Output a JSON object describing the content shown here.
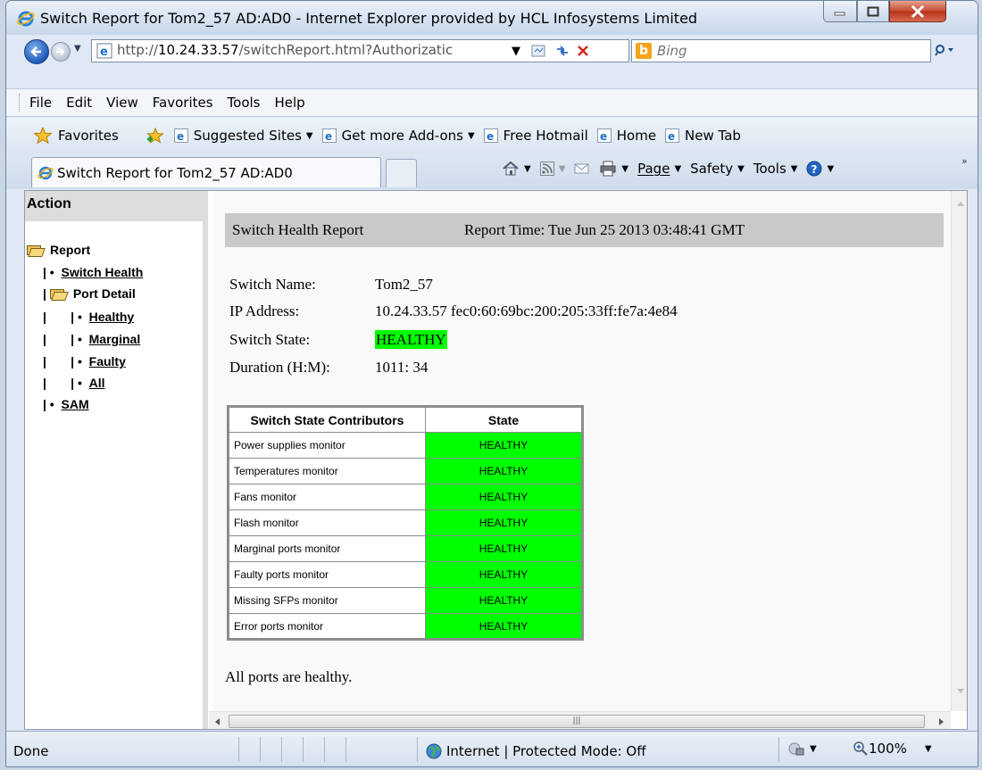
{
  "window": {
    "title": "Switch Report for Tom2_57 AD:AD0 - Internet Explorer provided by HCL Infosystems Limited"
  },
  "address": {
    "url_prefix": "http://",
    "url_host": "10.24.33.57",
    "url_path": "/switchReport.html?Authorizatic",
    "search_placeholder": "Bing"
  },
  "menu": [
    "File",
    "Edit",
    "View",
    "Favorites",
    "Tools",
    "Help"
  ],
  "favorites": {
    "label": "Favorites",
    "links": [
      "Suggested Sites",
      "Get more Add-ons",
      "Free Hotmail",
      "Home",
      "New Tab"
    ]
  },
  "tab": {
    "title": "Switch Report for Tom2_57 AD:AD0"
  },
  "commands": {
    "page": "Page",
    "safety": "Safety",
    "tools": "Tools"
  },
  "left_frame": {
    "header": "Action",
    "tree": {
      "report": "Report",
      "switch_health": "Switch Health",
      "port_detail": "Port Detail",
      "healthy": "Healthy",
      "marginal": "Marginal",
      "faulty": "Faulty",
      "all": "All",
      "sam": "SAM"
    }
  },
  "report": {
    "title": "Switch Health Report",
    "time": "Report Time: Tue Jun 25 2013 03:48:41 GMT",
    "switch_name_label": "Switch Name:",
    "switch_name": "Tom2_57",
    "ip_label": "IP Address:",
    "ip": "10.24.33.57 fec0:60:69bc:200:205:33ff:fe7a:4e84",
    "state_label": "Switch State:",
    "state": "HEALTHY",
    "duration_label": "Duration (H:M):",
    "duration": "1011: 34",
    "table": {
      "headers": [
        "Switch State Contributors",
        "State"
      ],
      "rows": [
        [
          "Power supplies monitor",
          "HEALTHY"
        ],
        [
          "Temperatures monitor",
          "HEALTHY"
        ],
        [
          "Fans monitor",
          "HEALTHY"
        ],
        [
          "Flash monitor",
          "HEALTHY"
        ],
        [
          "Marginal ports monitor",
          "HEALTHY"
        ],
        [
          "Faulty ports monitor",
          "HEALTHY"
        ],
        [
          "Missing SFPs monitor",
          "HEALTHY"
        ],
        [
          "Error ports monitor",
          "HEALTHY"
        ]
      ]
    },
    "footer": "All ports are healthy."
  },
  "status": {
    "text": "Done",
    "zone": "Internet | Protected Mode: Off",
    "zoom": "100%"
  },
  "colors": {
    "healthy": "#00ff00",
    "header_gray": "#c9c9c9"
  }
}
